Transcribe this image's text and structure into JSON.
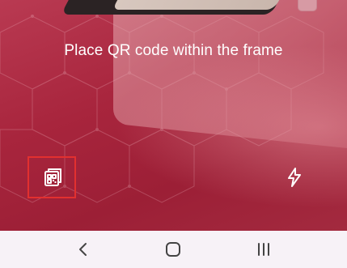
{
  "scanner": {
    "instruction": "Place QR code within the frame",
    "gallery_icon": "qr-gallery-icon",
    "flash_icon": "flash-off-icon"
  },
  "navigation": {
    "back_icon": "back-icon",
    "home_icon": "home-icon",
    "recents_icon": "recent-apps-icon"
  },
  "colors": {
    "highlight_border": "#e2302f",
    "camera_background": "#a8253d",
    "nav_background": "#f7f2f7"
  }
}
